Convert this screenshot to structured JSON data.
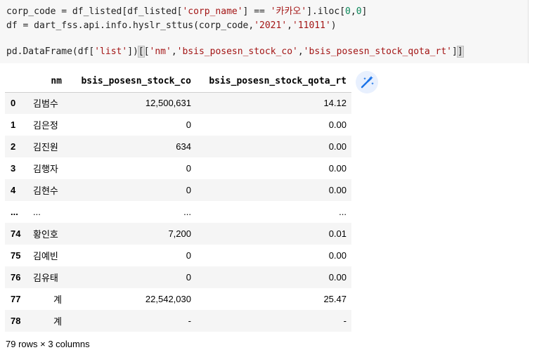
{
  "code": {
    "line1": {
      "a": "corp_code = df_listed[df_listed[",
      "s1": "'corp_name'",
      "b": "] == ",
      "s2": "'카카오'",
      "c": "].iloc[",
      "n1": "0",
      "d": ",",
      "n2": "0",
      "e": "]"
    },
    "line2": {
      "a": "df = dart_fss.api.info.hyslr_sttus(corp_code,",
      "s1": "'2021'",
      "b": ",",
      "s2": "'11011'",
      "c": ")"
    },
    "line4": {
      "a": "pd.DataFrame(df[",
      "s1": "'list'",
      "b": "])",
      "o": "[",
      "c": "[",
      "s2": "'nm'",
      "d": ",",
      "s3": "'bsis_posesn_stock_co'",
      "e": ",",
      "s4": "'bsis_posesn_stock_qota_rt'",
      "f": "]",
      "cl": "]"
    }
  },
  "magic_button": {
    "icon": "magic-wand-icon"
  },
  "table": {
    "columns": [
      "",
      "nm",
      "bsis_posesn_stock_co",
      "bsis_posesn_stock_qota_rt"
    ],
    "rows": [
      {
        "index": "0",
        "nm": "김범수",
        "co": "12,500,631",
        "rt": "14.12"
      },
      {
        "index": "1",
        "nm": "김은정",
        "co": "0",
        "rt": "0.00"
      },
      {
        "index": "2",
        "nm": "김진원",
        "co": "634",
        "rt": "0.00"
      },
      {
        "index": "3",
        "nm": "김행자",
        "co": "0",
        "rt": "0.00"
      },
      {
        "index": "4",
        "nm": "김현수",
        "co": "0",
        "rt": "0.00"
      },
      {
        "index": "...",
        "nm": "...",
        "co": "...",
        "rt": "..."
      },
      {
        "index": "74",
        "nm": "황인호",
        "co": "7,200",
        "rt": "0.01"
      },
      {
        "index": "75",
        "nm": "김예빈",
        "co": "0",
        "rt": "0.00"
      },
      {
        "index": "76",
        "nm": "김유태",
        "co": "0",
        "rt": "0.00"
      },
      {
        "index": "77",
        "nm": "계",
        "co": "22,542,030",
        "rt": "25.47"
      },
      {
        "index": "78",
        "nm": "계",
        "co": "-",
        "rt": "-"
      }
    ]
  },
  "shape_text": "79 rows × 3 columns"
}
